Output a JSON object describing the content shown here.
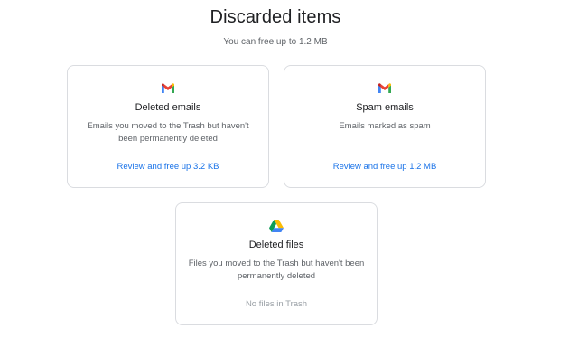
{
  "header": {
    "title": "Discarded items",
    "subtitle": "You can free up to 1.2 MB"
  },
  "cards": [
    {
      "icon": "gmail-icon",
      "title": "Deleted emails",
      "description": "Emails you moved to the Trash but haven't been permanently deleted",
      "action": "Review and free up 3.2 KB"
    },
    {
      "icon": "gmail-icon",
      "title": "Spam emails",
      "description": "Emails marked as spam",
      "action": "Review and free up 1.2 MB"
    },
    {
      "icon": "google-drive-icon",
      "title": "Deleted files",
      "description": "Files you moved to the Trash but haven't been permanently deleted",
      "action": "No files in Trash"
    }
  ],
  "colors": {
    "link": "#1a73e8",
    "disabled_text": "#9aa0a6",
    "border": "#dadce0"
  }
}
